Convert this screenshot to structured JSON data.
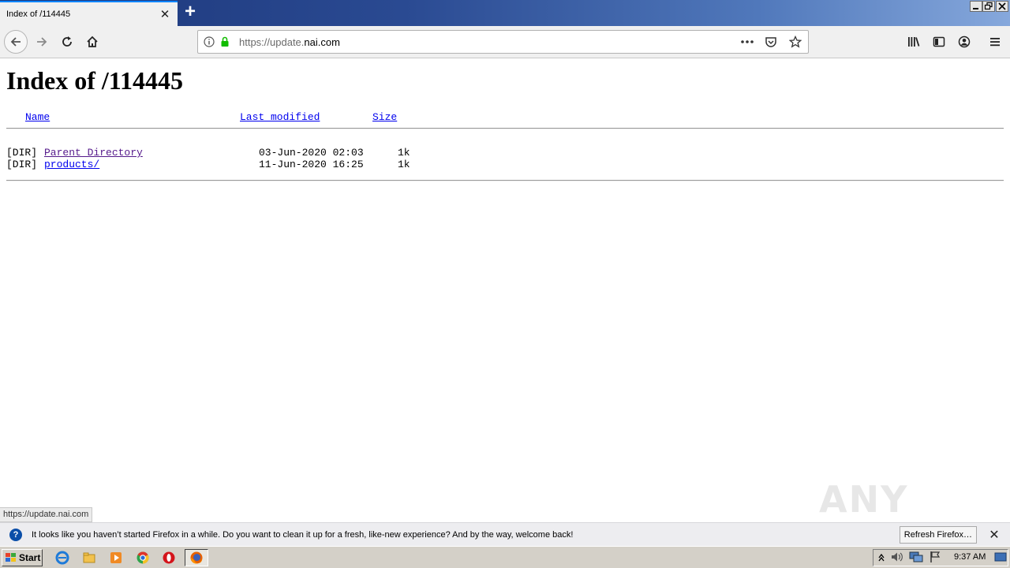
{
  "browser": {
    "tab_title": "Index of /114445",
    "new_tab_label": "+",
    "tab_close_label": "✕",
    "url_prefix": "https://update.",
    "url_host": "nai.com",
    "status_url": "https://update.nai.com"
  },
  "page": {
    "heading": "Index of /114445",
    "columns": {
      "name": "Name",
      "last_modified": "Last modified",
      "size": "Size"
    },
    "rows": [
      {
        "type": "[DIR]",
        "name": "Parent Directory",
        "modified": "03-Jun-2020 02:03",
        "size": "1k"
      },
      {
        "type": "[DIR]",
        "name": "products/",
        "modified": "11-Jun-2020 16:25",
        "size": "1k"
      }
    ]
  },
  "notification": {
    "message": "It looks like you haven’t started Firefox in a while. Do you want to clean it up for a fresh, like-new experience? And by the way, welcome back!",
    "button_label": "Refresh Firefox…",
    "close_label": "✕"
  },
  "taskbar": {
    "start_label": "Start",
    "clock": "9:37 AM"
  },
  "watermark": "ANY RUN",
  "colors": {
    "link": "#0000ee",
    "visited_link": "#551a8b",
    "secure_lock": "#12bc00",
    "tab_accent": "#0a84ff"
  }
}
